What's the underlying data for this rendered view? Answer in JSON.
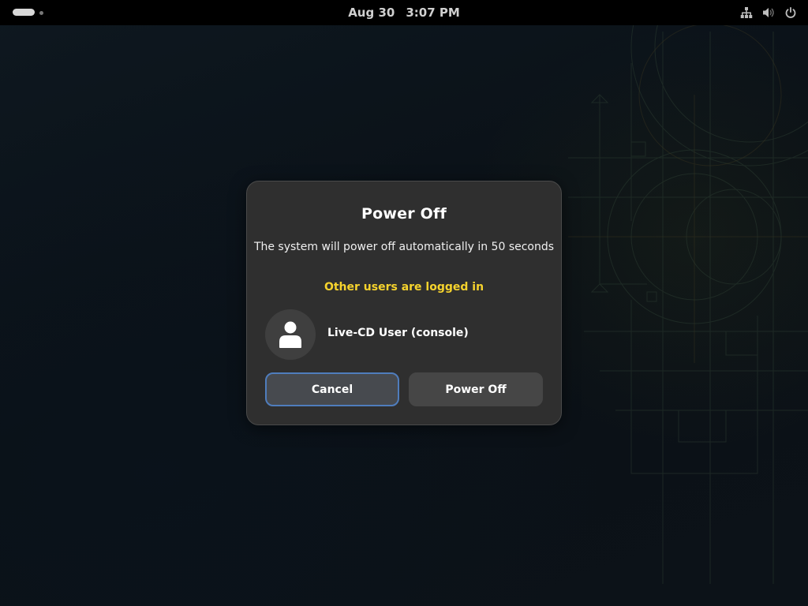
{
  "topbar": {
    "date": "Aug 30",
    "time": "3:07 PM",
    "tray_icons": [
      "network-wired-icon",
      "volume-muted-icon",
      "power-icon"
    ]
  },
  "dialog": {
    "title": "Power Off",
    "description": "The system will power off automatically in 50 seconds",
    "warning": "Other users are logged in",
    "user": {
      "name": "Live-CD User (console)",
      "avatar_icon": "user-avatar-icon"
    },
    "cancel_label": "Cancel",
    "power_off_label": "Power Off"
  },
  "colors": {
    "warning": "#f6d32d",
    "dialog_bg": "#2f2f2f",
    "focus_ring": "#4f7dbd",
    "topbar_bg": "#000000"
  }
}
